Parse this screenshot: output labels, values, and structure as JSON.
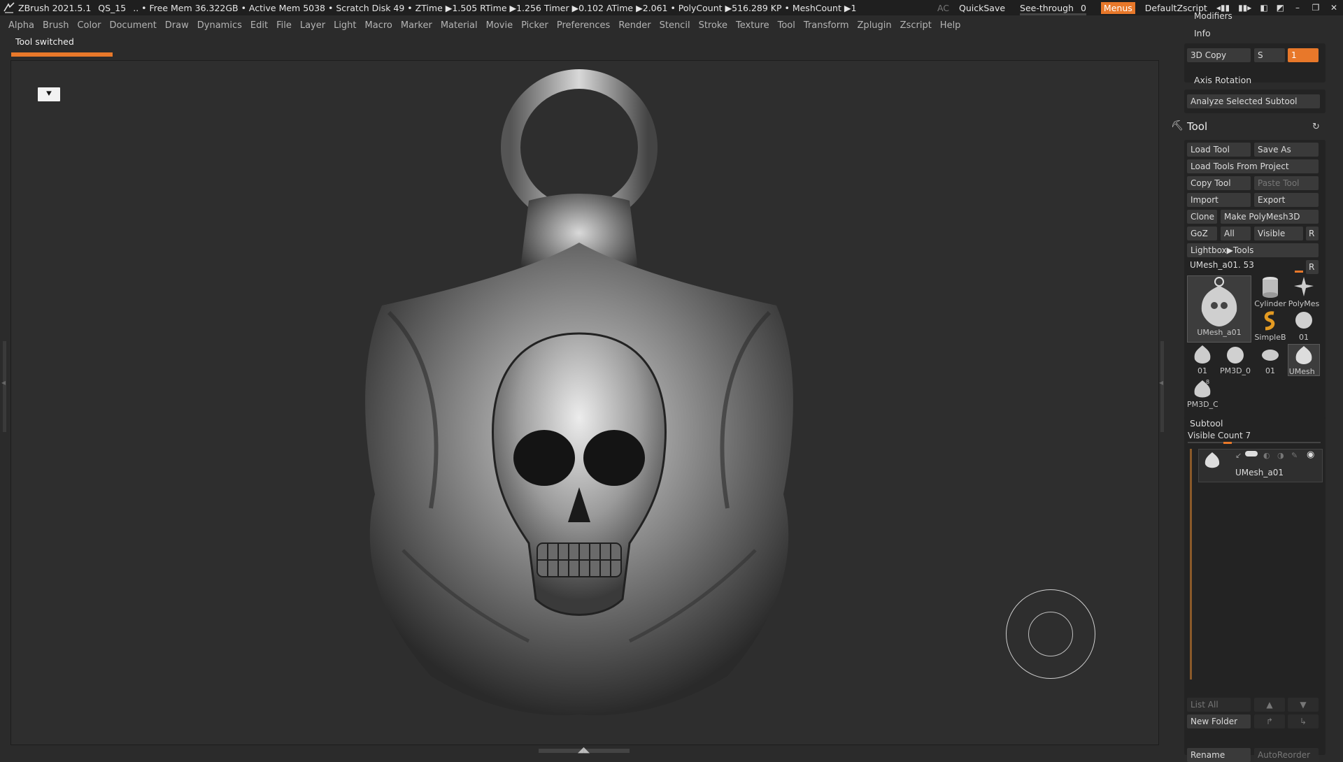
{
  "titlebar": {
    "app": "ZBrush 2021.5.1",
    "project": "QS_15",
    "stats": ".. • Free Mem 36.322GB • Active Mem 5038 • Scratch Disk 49 • ZTime ▶1.505 RTime ▶1.256 Timer ▶0.102 ATime ▶2.061 • PolyCount ▶516.289 KP • MeshCount ▶1",
    "ac": "AC",
    "quicksave": "QuickSave",
    "seethrough_label": "See-through",
    "seethrough_value": "0",
    "seethrough_fraction": 0.1,
    "menus": "Menus",
    "script": "DefaultZscript",
    "accent_color": "#e8782a"
  },
  "menubar": {
    "items": [
      "Alpha",
      "Brush",
      "Color",
      "Document",
      "Draw",
      "Dynamics",
      "Edit",
      "File",
      "Layer",
      "Light",
      "Macro",
      "Marker",
      "Material",
      "Movie",
      "Picker",
      "Preferences",
      "Render",
      "Stencil",
      "Stroke",
      "Texture",
      "Tool",
      "Transform",
      "Zplugin",
      "Zscript",
      "Help"
    ]
  },
  "status": {
    "note": "Tool switched"
  },
  "tray": {
    "top": {
      "modifiers": "Modifiers",
      "info": "Info",
      "copy3d": "3D Copy",
      "s_label": "S",
      "copy_value": "1",
      "axis_rotation": "Axis Rotation",
      "analyze": "Analyze Selected Subtool"
    },
    "tool": {
      "title": "Tool",
      "load_tool": "Load Tool",
      "save_as": "Save As",
      "load_from_project": "Load Tools From Project",
      "copy_tool": "Copy Tool",
      "paste_tool": "Paste Tool",
      "import": "Import",
      "export": "Export",
      "clone": "Clone",
      "make_polymesh": "Make PolyMesh3D",
      "goz": "GoZ",
      "all": "All",
      "visible": "Visible",
      "r": "R",
      "lightbox_tools": "Lightbox▶Tools",
      "current_tool": "UMesh_a01. 53",
      "current_r": "R",
      "thumbs": {
        "main": "UMesh_a01",
        "cylinder": "Cylinder",
        "polymesh": "PolyMes",
        "simpleb": "SimpleB",
        "small1": "01",
        "row3_1": "01",
        "row3_2": "PM3D_0",
        "row3_3": "01",
        "row3_4": "UMesh_",
        "row4_1": "PM3D_C",
        "row4_1_num": "8"
      }
    },
    "subtool": {
      "title": "Subtool",
      "visible_count": "Visible Count 7",
      "item_name": "UMesh_a01",
      "list_all": "List All",
      "new_folder": "New Folder",
      "rename": "Rename",
      "autoreorder": "AutoReorder"
    }
  }
}
